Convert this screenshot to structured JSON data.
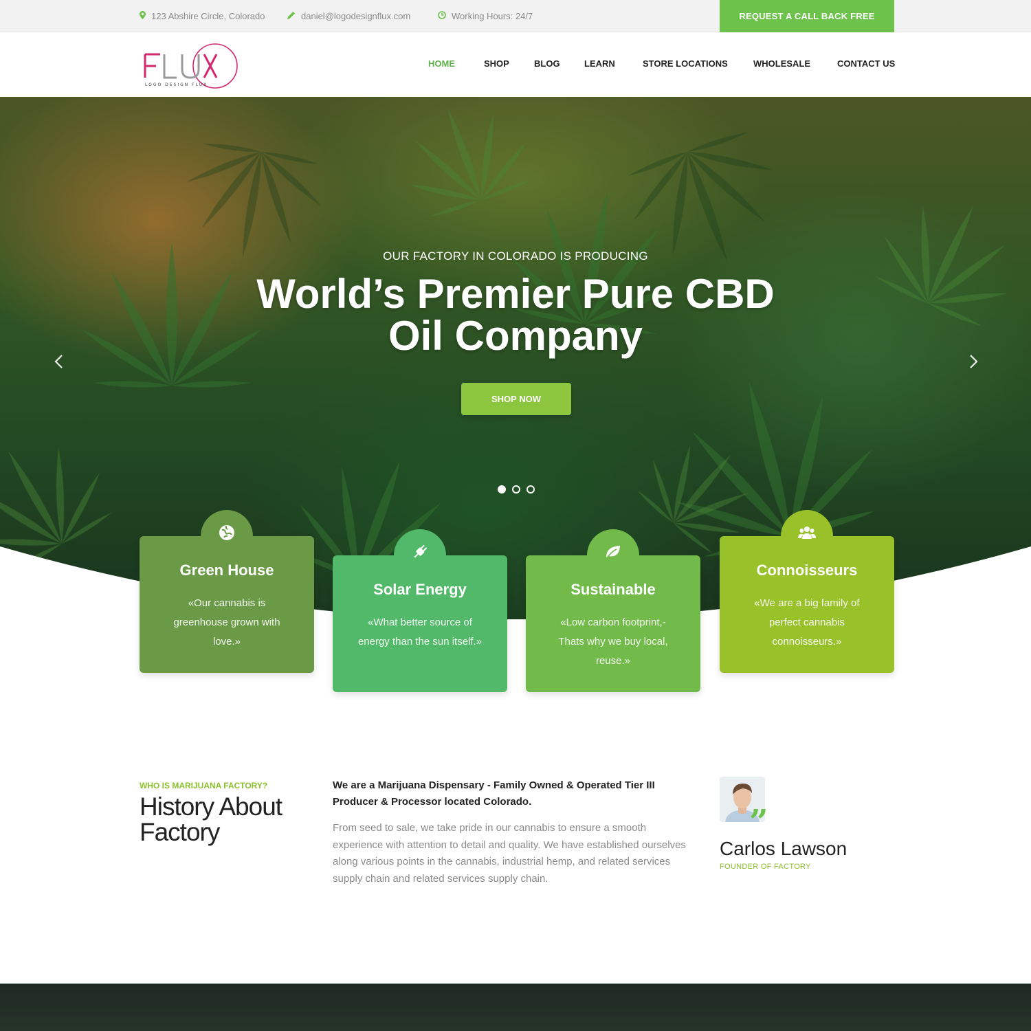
{
  "topbar": {
    "address": "123 Abshire Circle, Colorado",
    "email": "daniel@logodesignflux.com",
    "hours": "Working Hours: 24/7",
    "callback_label": "REQUEST A CALL BACK FREE"
  },
  "brand": {
    "logo_text": "FLUX",
    "logo_tagline": "LOGO DESIGN FLUX",
    "colors": {
      "accent": "#6cc24a",
      "pink": "#d1286f"
    }
  },
  "nav": {
    "items": [
      "HOME",
      "SHOP",
      "BLOG",
      "LEARN",
      "STORE LOCATIONS",
      "WHOLESALE",
      "CONTACT US"
    ],
    "active": "HOME"
  },
  "hero": {
    "subtitle": "OUR FACTORY IN COLORADO IS PRODUCING",
    "title_line1": "World’s Premier Pure CBD",
    "title_line2": "Oil Company",
    "cta": "SHOP NOW",
    "slide_count": 3,
    "active_slide": 1
  },
  "features": [
    {
      "icon": "globe-icon",
      "title": "Green House",
      "text": "«Our cannabis is greenhouse grown with love.»",
      "color": "#6a9a45"
    },
    {
      "icon": "plug-icon",
      "title": "Solar Energy",
      "text": "«What better source of energy than the sun itself.»",
      "color": "#52b96a"
    },
    {
      "icon": "leaf-icon",
      "title": "Sustainable",
      "text": "«Low carbon footprint,- Thats why we buy local, reuse.»",
      "color": "#72bb4a"
    },
    {
      "icon": "users-icon",
      "title": "Connoisseurs",
      "text": "«We are a big family of perfect cannabis connoisseurs.»",
      "color": "#98c12a"
    }
  ],
  "about": {
    "kicker": "WHO IS MARIJUANA FACTORY?",
    "title": "History About Factory",
    "lead": "We are a Marijuana Dispensary - Family Owned & Operated Tier III Producer & Processor located Colorado.",
    "body": "From seed to sale, we take pride in our cannabis to ensure a smooth experience with attention to detail and quality. We have established ourselves along various points in the cannabis, industrial hemp, and related services supply chain and related services supply chain.",
    "person_name": "Carlos Lawson",
    "person_role": "FOUNDER OF FACTORY",
    "quote_glyph": "”"
  }
}
